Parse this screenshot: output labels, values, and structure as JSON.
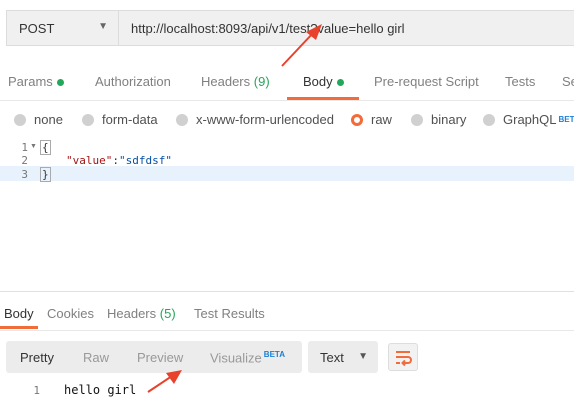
{
  "request": {
    "method": "POST",
    "url": "http://localhost:8093/api/v1/test?value=hello girl"
  },
  "request_tabs": [
    {
      "label": "Params",
      "dot": true
    },
    {
      "label": "Authorization"
    },
    {
      "label": "Headers",
      "count": "(9)"
    },
    {
      "label": "Body",
      "dot": true,
      "active": true
    },
    {
      "label": "Pre-request Script"
    },
    {
      "label": "Tests"
    },
    {
      "label": "Se"
    }
  ],
  "body_types": [
    {
      "label": "none"
    },
    {
      "label": "form-data"
    },
    {
      "label": "x-www-form-urlencoded"
    },
    {
      "label": "raw",
      "selected": true
    },
    {
      "label": "binary"
    },
    {
      "label": "GraphQL",
      "badge": "BETA"
    }
  ],
  "editor": {
    "line_numbers": [
      "1",
      "2",
      "3"
    ],
    "line1": "{",
    "line2_key": "\"value\"",
    "line2_colon": ":",
    "line2_value": "\"sdfdsf\"",
    "line3": "}"
  },
  "response_tabs": [
    {
      "label": "Body",
      "active": true
    },
    {
      "label": "Cookies"
    },
    {
      "label": "Headers",
      "count": "(5)"
    },
    {
      "label": "Test Results"
    }
  ],
  "response_toolbar": {
    "views": [
      "Pretty",
      "Raw",
      "Preview",
      "Visualize"
    ],
    "visualize_badge": "BETA",
    "format": "Text"
  },
  "response": {
    "line_number": "1",
    "body": "hello girl"
  },
  "colors": {
    "accent": "#f26b3a",
    "green": "#26a65b",
    "arrow": "#e8412c"
  }
}
